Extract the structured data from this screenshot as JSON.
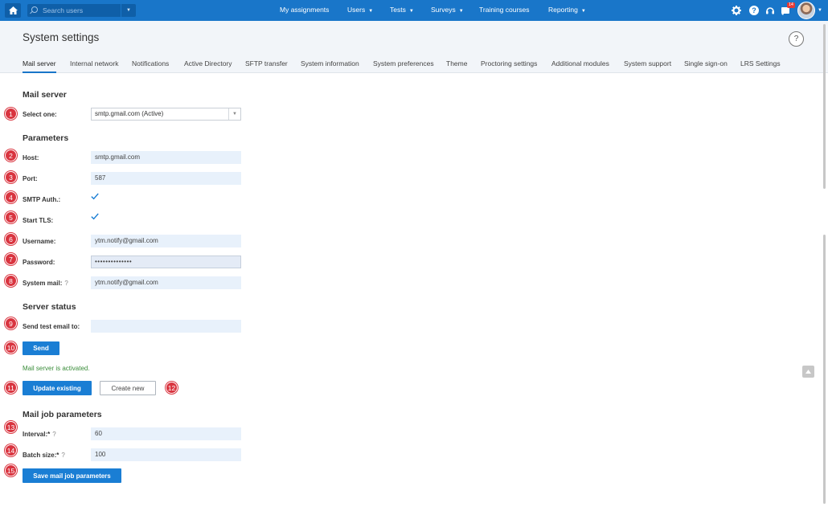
{
  "topnav": {
    "search_placeholder": "Search users",
    "items": [
      {
        "label": "My assignments",
        "caret": false
      },
      {
        "label": "Users",
        "caret": true
      },
      {
        "label": "Tests",
        "caret": true
      },
      {
        "label": "Surveys",
        "caret": true
      },
      {
        "label": "Training courses",
        "caret": false
      },
      {
        "label": "Reporting",
        "caret": true
      }
    ],
    "notification_count": "14",
    "icons": [
      "home-icon",
      "search-icon",
      "gear-icon",
      "help-icon",
      "headset-icon",
      "notification-icon",
      "avatar"
    ]
  },
  "header": {
    "title": "System settings",
    "help": "?",
    "tabs": [
      "Mail server",
      "Internal network",
      "Notifications",
      "Active Directory",
      "SFTP transfer",
      "System information",
      "System preferences",
      "Theme",
      "Proctoring settings",
      "Additional modules",
      "System support",
      "Single sign-on",
      "LRS Settings"
    ],
    "active_tab": "Mail server"
  },
  "mail_server": {
    "title": "Mail server",
    "select_label": "Select one:",
    "selected": "smtp.gmail.com (Active)"
  },
  "parameters": {
    "title": "Parameters",
    "host_label": "Host:",
    "host": "smtp.gmail.com",
    "port_label": "Port:",
    "port": "587",
    "smtp_auth_label": "SMTP Auth.:",
    "smtp_auth": true,
    "start_tls_label": "Start TLS:",
    "start_tls": true,
    "username_label": "Username:",
    "username": "ytm.notify@gmail.com",
    "password_label": "Password:",
    "password": "••••••••••••••",
    "system_mail_label": "System mail:",
    "system_mail": "ytm.notify@gmail.com",
    "help_mark": "?"
  },
  "server_status": {
    "title": "Server status",
    "test_label": "Send test email to:",
    "test_value": "",
    "send_label": "Send",
    "status": "Mail server is activated.",
    "update_label": "Update existing",
    "create_label": "Create new"
  },
  "mail_job": {
    "title": "Mail job parameters",
    "interval_label": "Interval:*",
    "interval": "60",
    "batch_label": "Batch size:*",
    "batch": "100",
    "save_label": "Save mail job parameters"
  },
  "markers": [
    "1",
    "2",
    "3",
    "4",
    "5",
    "6",
    "7",
    "8",
    "9",
    "10",
    "11",
    "12",
    "13",
    "14",
    "15"
  ],
  "colors": {
    "nav": "#1976c9",
    "primary_button": "#1a7ed4",
    "marker": "#d9343f",
    "status_ok": "#3a8d3a",
    "field_bg": "#e8f1fb"
  }
}
